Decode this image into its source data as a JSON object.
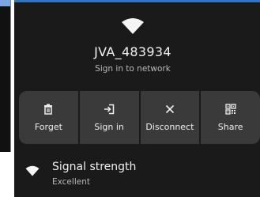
{
  "network": {
    "ssid": "JVA_483934",
    "status": "Sign in to network"
  },
  "actions": [
    {
      "label": "Forget",
      "icon": "trash-icon"
    },
    {
      "label": "Sign in",
      "icon": "sign-in-icon"
    },
    {
      "label": "Disconnect",
      "icon": "close-icon"
    },
    {
      "label": "Share",
      "icon": "qr-code-icon"
    }
  ],
  "signal": {
    "title": "Signal strength",
    "value": "Excellent",
    "icon": "wifi-icon"
  },
  "colors": {
    "background": "#1a1a1a",
    "button_bg": "#3a3a3a",
    "text_primary": "#f0f0f0",
    "text_secondary": "#b8b8b8",
    "accent_line": "#2f74c0"
  }
}
